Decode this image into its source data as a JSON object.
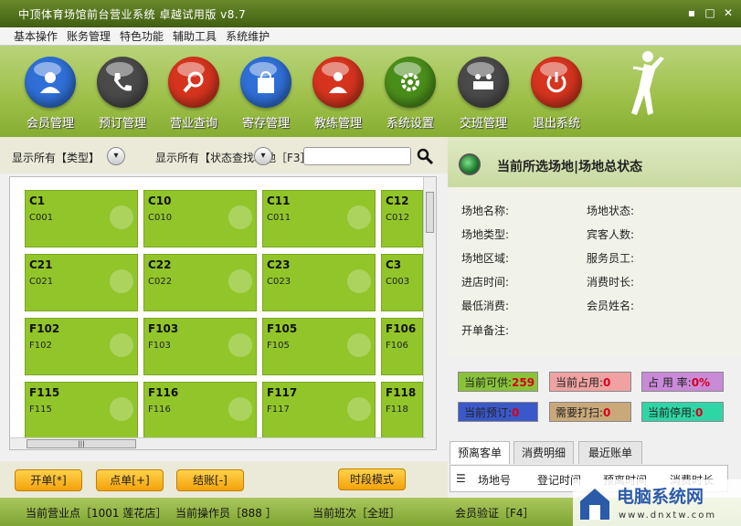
{
  "window": {
    "title": "中顶体育场馆前台营业系统 卓越试用版 v8.7",
    "controls": [
      "▪",
      "□",
      "✕"
    ]
  },
  "menu": [
    "基本操作",
    "账务管理",
    "特色功能",
    "辅助工具",
    "系统维护"
  ],
  "toolbar": [
    {
      "label": "会员管理",
      "color": "#2f6fd6",
      "icon": "member-icon"
    },
    {
      "label": "预订管理",
      "color": "#4a4a4a",
      "icon": "phone-icon"
    },
    {
      "label": "营业查询",
      "color": "#d6341e",
      "icon": "magnifier-icon"
    },
    {
      "label": "寄存管理",
      "color": "#2f6fd6",
      "icon": "bag-icon"
    },
    {
      "label": "教练管理",
      "color": "#d6341e",
      "icon": "coach-icon"
    },
    {
      "label": "系统设置",
      "color": "#4a8e1a",
      "icon": "gear-icon"
    },
    {
      "label": "交班管理",
      "color": "#4a4a4a",
      "icon": "handover-icon"
    },
    {
      "label": "退出系统",
      "color": "#d6341e",
      "icon": "power-icon"
    }
  ],
  "filters": {
    "type_label": "显示所有【类型】",
    "status_label": "显示所有【状态查找场地［F3］"
  },
  "venues": [
    {
      "code": "C1",
      "sub": "C001"
    },
    {
      "code": "C10",
      "sub": "C010"
    },
    {
      "code": "C11",
      "sub": "C011"
    },
    {
      "code": "C12",
      "sub": "C012"
    },
    {
      "code": "C21",
      "sub": "C021"
    },
    {
      "code": "C22",
      "sub": "C022"
    },
    {
      "code": "C23",
      "sub": "C023"
    },
    {
      "code": "C3",
      "sub": "C003"
    },
    {
      "code": "F102",
      "sub": "F102"
    },
    {
      "code": "F103",
      "sub": "F103"
    },
    {
      "code": "F105",
      "sub": "F105"
    },
    {
      "code": "F106",
      "sub": "F106"
    },
    {
      "code": "F115",
      "sub": "F115"
    },
    {
      "code": "F116",
      "sub": "F116"
    },
    {
      "code": "F117",
      "sub": "F117"
    },
    {
      "code": "F118",
      "sub": "F118"
    }
  ],
  "right_panel": {
    "title": "当前所选场地|场地总状态",
    "info_left": [
      "场地名称:",
      "场地类型:",
      "场地区域:",
      "进店时间:",
      "最低消费:",
      "开单备注:"
    ],
    "info_right": [
      "场地状态:",
      "宾客人数:",
      "服务员工:",
      "消费时长:",
      "会员姓名:"
    ]
  },
  "stats": [
    {
      "label": "当前可供:",
      "value": "259",
      "bg": "#8ac33a",
      "value_color": "#d6001c"
    },
    {
      "label": "当前占用:",
      "value": "0",
      "bg": "#f0a2a2",
      "value_color": "#d6001c"
    },
    {
      "label": "占 用 率:",
      "value": "0%",
      "bg": "#c98ad8",
      "value_color": "#d6001c"
    },
    {
      "label": "当前预订:",
      "value": "0",
      "bg": "#3a58c9",
      "value_color": "#d6001c"
    },
    {
      "label": "需要打扫:",
      "value": "0",
      "bg": "#c9a97a",
      "value_color": "#d6001c"
    },
    {
      "label": "当前停用:",
      "value": "0",
      "bg": "#2fd6a5",
      "value_color": "#d6001c"
    }
  ],
  "tabs": [
    "预离客单",
    "消费明细",
    "最近账单"
  ],
  "list_columns": [
    "场地号",
    "登记时间",
    "预离时间",
    "消费时长"
  ],
  "buttons": {
    "open": "开单[*]",
    "order": "点单[+]",
    "checkout": "结账[-]",
    "time_mode": "时段模式"
  },
  "statusbar": {
    "outlet": "当前营业点［1001 莲花店］",
    "operator": "当前操作员［888 ］",
    "shift": "当前班次［全班］",
    "verify": "会员验证［F4］"
  },
  "watermark": {
    "title": "电脑系统网",
    "url": "www.dnxtw.com"
  }
}
